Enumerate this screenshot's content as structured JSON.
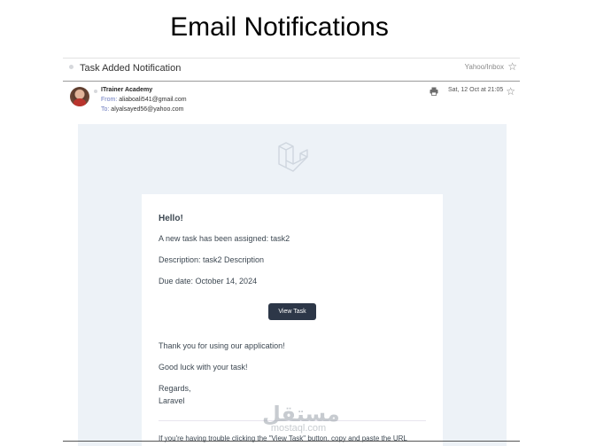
{
  "slide": {
    "title": "Email Notifications"
  },
  "email": {
    "subject": "Task Added Notification",
    "folder": "Yahoo/Inbox",
    "sender_name": "ITrainer Academy",
    "from_label": "From:",
    "from_address": "aliaboali541@gmail.com",
    "to_label": "To:",
    "to_address": "alyalsayed56@yahoo.com",
    "date": "Sat, 12 Oct at 21:05",
    "icons": {
      "star": "star-outline-icon",
      "print": "printer-icon",
      "logo": "laravel-logo-icon"
    }
  },
  "body": {
    "greeting": "Hello!",
    "line_assigned": "A new task has been assigned: task2",
    "line_description": "Description: task2 Description",
    "line_due": "Due date: October 14, 2024",
    "button_label": "View Task",
    "line_thanks": "Thank you for using our application!",
    "line_luck": "Good luck with your task!",
    "line_regards": "Regards,",
    "line_signature": "Laravel",
    "trouble_text": "If you're having trouble clicking the \"View Task\" button, copy and paste the URL"
  },
  "watermark": {
    "arabic": "مستقل",
    "latin": "mostaql.com"
  },
  "colors": {
    "body_bg": "#edf2f7",
    "button_bg": "#2d3748",
    "text": "#3d4852",
    "label_blue": "#6b7abf"
  }
}
